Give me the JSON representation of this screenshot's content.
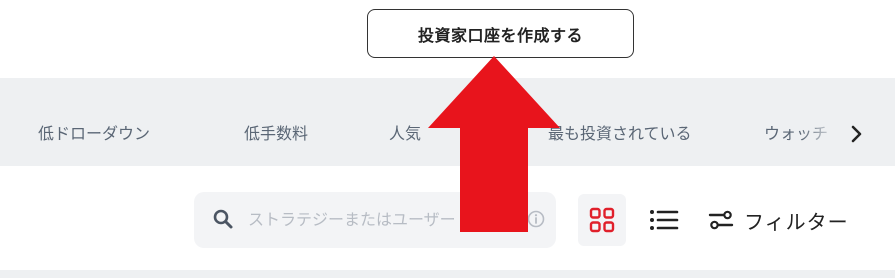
{
  "header": {
    "cta_label": "投資家口座を作成する"
  },
  "tabs": [
    {
      "label": "低ドローダウン"
    },
    {
      "label": "低手数料"
    },
    {
      "label": "人気"
    },
    {
      "label": "最も投資されている"
    },
    {
      "label": "ウォッチ"
    }
  ],
  "search": {
    "placeholder": "ストラテジーまたはユーザー"
  },
  "toolbar": {
    "filter_label": "フィルター"
  },
  "colors": {
    "accent_red": "#e0202b",
    "arrow_red": "#e8141c"
  },
  "icons": [
    "search-icon",
    "info-icon",
    "grid-view-icon",
    "list-view-icon",
    "filter-sliders-icon",
    "chevron-right-icon",
    "red-up-arrow"
  ]
}
